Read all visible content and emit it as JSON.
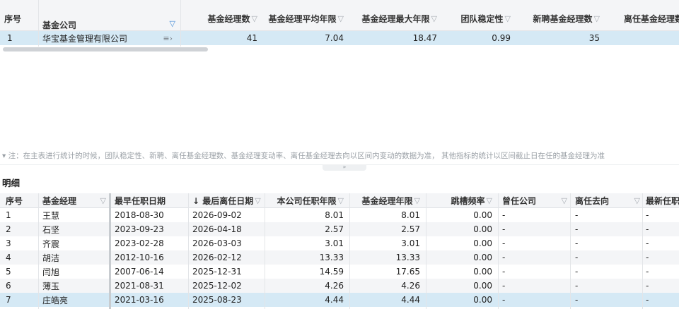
{
  "summary": {
    "headers": {
      "index": "序号",
      "company": "基金公司",
      "manager_count": "基金经理数",
      "avg_years": "基金经理平均年限",
      "max_years": "基金经理最大年限",
      "team_stability": "团队稳定性",
      "new_managers": "新聘基金经理数",
      "departed_managers": "离任基金经理数"
    },
    "row": {
      "index": "1",
      "company": "华宝基金管理有限公司",
      "manager_count": "41",
      "avg_years": "7.04",
      "max_years": "18.47",
      "team_stability": "0.99",
      "new_managers": "35",
      "departed_managers": ""
    }
  },
  "note": "▾ 注：在主表进行统计的时候，团队稳定性、新聘、离任基金经理数、基金经理变动率、离任基金经理去向以区间内变动的数据为准， 其他指标的统计以区间截止日在任的基金经理为准",
  "collapse_glyph": "»",
  "detail": {
    "title": "明细",
    "headers": {
      "index": "序号",
      "manager": "基金经理",
      "first_date": "最早任职日期",
      "last_leave": "↓ 最后离任日期",
      "tenure_company": "本公司任职年限",
      "tenure_total": "基金经理年限",
      "hop_freq": "跳槽频率",
      "prev_company": "曾任公司",
      "destination": "离任去向",
      "latest": "最新任职"
    },
    "rows": [
      {
        "index": "1",
        "manager": "王慧",
        "first_date": "2018-08-30",
        "last_leave": "2026-09-02",
        "tenure_company": "8.01",
        "tenure_total": "8.01",
        "hop_freq": "0.00",
        "prev_company": "-",
        "destination": "-",
        "latest": "-"
      },
      {
        "index": "2",
        "manager": "石坚",
        "first_date": "2023-09-23",
        "last_leave": "2026-04-18",
        "tenure_company": "2.57",
        "tenure_total": "2.57",
        "hop_freq": "0.00",
        "prev_company": "-",
        "destination": "-",
        "latest": "-"
      },
      {
        "index": "3",
        "manager": "齐震",
        "first_date": "2023-02-28",
        "last_leave": "2026-03-03",
        "tenure_company": "3.01",
        "tenure_total": "3.01",
        "hop_freq": "0.00",
        "prev_company": "-",
        "destination": "-",
        "latest": "-"
      },
      {
        "index": "4",
        "manager": "胡洁",
        "first_date": "2012-10-16",
        "last_leave": "2026-02-12",
        "tenure_company": "13.33",
        "tenure_total": "13.33",
        "hop_freq": "0.00",
        "prev_company": "-",
        "destination": "-",
        "latest": "-"
      },
      {
        "index": "5",
        "manager": "闫旭",
        "first_date": "2007-06-14",
        "last_leave": "2025-12-31",
        "tenure_company": "14.59",
        "tenure_total": "17.65",
        "hop_freq": "0.00",
        "prev_company": "-",
        "destination": "-",
        "latest": "-"
      },
      {
        "index": "6",
        "manager": "薄玉",
        "first_date": "2021-08-31",
        "last_leave": "2025-12-02",
        "tenure_company": "4.26",
        "tenure_total": "4.26",
        "hop_freq": "0.00",
        "prev_company": "-",
        "destination": "-",
        "latest": "-"
      },
      {
        "index": "7",
        "manager": "庄皓亮",
        "first_date": "2021-03-16",
        "last_leave": "2025-08-23",
        "tenure_company": "4.44",
        "tenure_total": "4.44",
        "hop_freq": "0.00",
        "prev_company": "-",
        "destination": "-",
        "latest": "-"
      }
    ]
  },
  "icons": {
    "filter": "filter-icon",
    "filter_active": "filter-active-icon",
    "row_menu": "row-menu-icon",
    "collapse": "collapse-icon"
  },
  "colors": {
    "header_bg": "#f4f5f7",
    "selected_row": "#d5e9f5",
    "filter_active": "#4a90d9"
  }
}
